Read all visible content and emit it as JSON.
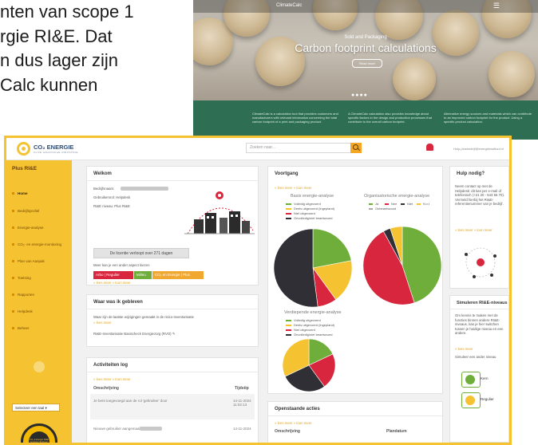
{
  "document": {
    "lines": [
      "nten van scope 1",
      "rgie RI&E. Dat",
      "n dus lager zijn",
      "Calc kunnen"
    ]
  },
  "background_site": {
    "logo": "ClimateCalc",
    "menu_icon": "hamburger-icon",
    "hero_subtitle": "Sold and Packaging",
    "hero_title": "Carbon footprint calculations",
    "hero_button": "Read more",
    "columns": [
      "ClimateCalc is a calculation tool that provides customers and manufacturers with relevant information concerning the total carbon footprint of a print and packaging product.",
      "A ClimateCalc calculation also provides knowledge about specific factors in the design and production processes that contribute to the overall carbon footprint.",
      "Alternative energy sources and materials which can contribute to an improved carbon footprint for the product. Using a specific product calculation."
    ]
  },
  "header": {
    "logo_text": "CO₂ ENERGIE",
    "logo_tag": "IN DE GRAFISCHE INDUSTRIE",
    "search_placeholder": "Zoeken naar...",
    "user_text": "Hulp.plusbedrijf@energieinstituut.nl"
  },
  "sidebar": {
    "title": "Plus RI&E",
    "items": [
      {
        "label": "Home",
        "active": true
      },
      {
        "label": "Bedrijfsprofiel"
      },
      {
        "label": "Energie-analyse"
      },
      {
        "label": "CO₂- en energie-monitoring"
      },
      {
        "label": "Plan van Aanpak"
      },
      {
        "label": "Toetsing"
      },
      {
        "label": "Rapporten"
      },
      {
        "label": "Helpdesk"
      },
      {
        "label": "Beheer"
      }
    ],
    "language_select": "Selecteer een taal",
    "badge_text": "CO₂ & Energie RI&E Graphium Bedrijven"
  },
  "welkom": {
    "title": "Welkom",
    "rows": [
      "Bedrijfsnaam:",
      "Gebruikersrol: Helpdesk",
      "RI&E niveau: Plus RI&E"
    ],
    "license_button": "De licentie verloopt over 271 dagen",
    "more_text": "Meer kan je een ander aspect kiezen",
    "tags": [
      {
        "label": "Arbo | Regulier",
        "color": "#d7263d"
      },
      {
        "label": "Milieu",
        "color": "#6fae3a"
      },
      {
        "label": "CO₂ en Energie | Plus",
        "color": "#f0a830"
      }
    ],
    "links": "« lees meer » toon meer"
  },
  "waar": {
    "title": "Waar was ik gebleven",
    "text": "Waar zijn de laatste wijzigingen gemaakt in de risico-inventarisatie",
    "link": "« lees meer",
    "item": "RI&E-Inventarisatie Basischeck Energiezorg (RVO)"
  },
  "activiteiten": {
    "title": "Activiteiten log",
    "links": "« lees meer » toon meer",
    "col_desc": "Omschrijving",
    "col_time": "Tijdstip",
    "rows": [
      {
        "desc": "Je bent toegevoegd aan de rol 'gebruiker' door",
        "time": "14-11-2024 11:02:13"
      },
      {
        "desc": "Nieuwe gebruiker aangemaakt door",
        "time": "14-11-2024"
      }
    ]
  },
  "voortgang": {
    "title": "Voortgang",
    "links": "« lees meer » toon meer",
    "chart1_title": "Basis energie-analyse",
    "chart2_title": "Organisatorische energie-analyse",
    "chart3_title": "Verdiepende energie-analyse",
    "legend1": [
      {
        "label": "Volledig uitgevoerd",
        "color": "#6fae3a"
      },
      {
        "label": "Deels uitgevoerd (ingepland)",
        "color": "#f5c232"
      },
      {
        "label": "Niet uitgevoerd",
        "color": "#d7263d"
      },
      {
        "label": "Onvolledig/niet beantwoord",
        "color": "#2f2f35"
      }
    ],
    "legend2": [
      {
        "label": "Ja",
        "color": "#6fae3a"
      },
      {
        "label": "Nee",
        "color": "#d7263d"
      },
      {
        "label": "Niet",
        "color": "#2f2f35"
      },
      {
        "label": "N.v.t",
        "color": "#f5c232"
      },
      {
        "label": "Onbeantwoord",
        "color": "#aaaaaa"
      }
    ],
    "pie1": [
      {
        "value": 0.22,
        "color": "#6fae3a"
      },
      {
        "value": 0.18,
        "color": "#f5c232"
      },
      {
        "value": 0.08,
        "color": "#d7263d"
      },
      {
        "value": 0.52,
        "color": "#2f2f35"
      }
    ],
    "pie2": [
      {
        "value": 0.45,
        "color": "#6fae3a"
      },
      {
        "value": 0.47,
        "color": "#d7263d"
      },
      {
        "value": 0.03,
        "color": "#2f2f35"
      },
      {
        "value": 0.05,
        "color": "#f5c232"
      }
    ],
    "pie3": [
      {
        "value": 0.18,
        "color": "#6fae3a"
      },
      {
        "value": 0.22,
        "color": "#d7263d"
      },
      {
        "value": 0.28,
        "color": "#2f2f35"
      },
      {
        "value": 0.32,
        "color": "#f5c232"
      }
    ]
  },
  "openstaande": {
    "title": "Openstaande acties",
    "links": "« lees meer » toon meer",
    "col_desc": "Omschrijving",
    "col_date": "Plandatum"
  },
  "hulp": {
    "title": "Hulp nodig?",
    "text": "Neem contact op met de Helpdesk: dit kan per e-mail of telefonisch (+31 20 - 543 56 70). Vermeld hierbij het RI&E-referentienummer van je bedrijf.",
    "link": "« lees meer » toon meer"
  },
  "simuleren": {
    "title": "Simuleren RI&E-niveaus",
    "text": "Om kennis te maken met de functies binnen andere RI&E-niveaus, kan je hier switchen tussen je huidige niveau en een andere.",
    "link": "« lees meer",
    "sub": "Simuleer een ander niveau",
    "btn1": "Kern",
    "btn2": "Regulier"
  }
}
